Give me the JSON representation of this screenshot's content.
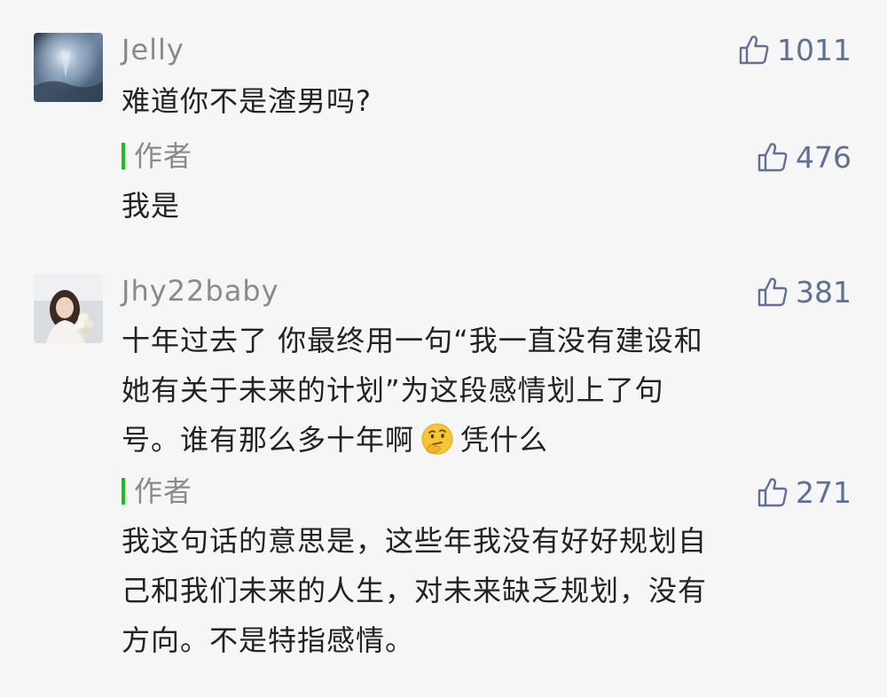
{
  "comments": [
    {
      "username": "Jelly",
      "likes": "1011",
      "text": "难道你不是渣男吗?",
      "reply": {
        "author_label": "作者",
        "likes": "476",
        "text": "我是"
      }
    },
    {
      "username": "Jhy22baby",
      "likes": "381",
      "text_line1": "十年过去了 你最终用一句“我一直没有建设和",
      "text_line2": "她有关于未来的计划”为这段感情划上了句",
      "text_line3a": "号。谁有那么多十年啊",
      "text_line3b": "凭什么",
      "emoji": "thinking-face-emoji",
      "reply": {
        "author_label": "作者",
        "likes": "271",
        "text_line1": "我这句话的意思是，这些年我没有好好规划自",
        "text_line2": "己和我们未来的人生，对未来缺乏规划，没有",
        "text_line3": "方向。不是特指感情。"
      }
    }
  ],
  "colors": {
    "background": "#f6f6f6",
    "author_bar": "#1fb923",
    "like_color": "#5f6f95",
    "username_color": "#8a8a8a"
  }
}
